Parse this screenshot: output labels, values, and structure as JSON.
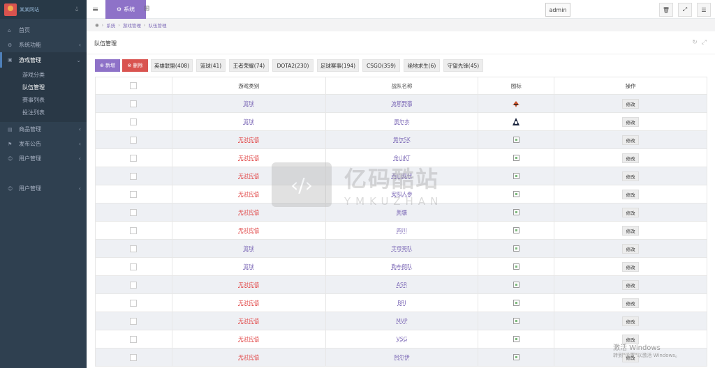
{
  "logo": {
    "text": "某某网站"
  },
  "sidebar": {
    "items": [
      {
        "label": "首页",
        "icon": "home-icon"
      },
      {
        "label": "系统功能",
        "icon": "gear-icon"
      },
      {
        "label": "游戏管理",
        "icon": "gamepad-icon"
      },
      {
        "label": "商品管理",
        "icon": "shop-icon"
      },
      {
        "label": "发布公告",
        "icon": "flag-icon"
      },
      {
        "label": "用户管理",
        "icon": "users-icon"
      },
      {
        "label": "用户管理",
        "icon": "users-icon"
      }
    ],
    "submenu": [
      "游戏分类",
      "队伍管理",
      "赛事列表",
      "投注列表"
    ]
  },
  "topbar": {
    "tab_label": "系统",
    "avatar_alt": "admin"
  },
  "breadcrumb": [
    "系统",
    "游戏管理",
    "队伍管理"
  ],
  "page": {
    "title": "队伍管理"
  },
  "toolbar": {
    "add_label": "新增",
    "delete_label": "删除"
  },
  "filters": [
    "英雄联盟(408)",
    "篮球(41)",
    "王者荣耀(74)",
    "DOTA2(230)",
    "足球赛事(194)",
    "CSGO(359)",
    "绝地求生(6)",
    "守望先锋(45)"
  ],
  "table": {
    "headers": [
      "游戏类别",
      "战队名称",
      "图标",
      "操作"
    ],
    "edit_label": "修改",
    "rows": [
      {
        "category": "篮球",
        "name": "波斯野猫",
        "icon": "logo-a"
      },
      {
        "category": "篮球",
        "name": "墨尔本",
        "icon": "logo-b"
      },
      {
        "category": "无对应值",
        "name": "黄尔SK",
        "icon": "broken"
      },
      {
        "category": "无对应值",
        "name": "金山KT",
        "icon": "broken"
      },
      {
        "category": "无对应值",
        "name": "西山现代",
        "icon": "broken"
      },
      {
        "category": "无对应值",
        "name": "安阳人参",
        "icon": "broken"
      },
      {
        "category": "无对应值",
        "name": "新疆",
        "icon": "broken"
      },
      {
        "category": "无对应值",
        "name": "四川",
        "icon": "broken"
      },
      {
        "category": "篮球",
        "name": "字母哥队",
        "icon": "broken"
      },
      {
        "category": "篮球",
        "name": "勒布朗队",
        "icon": "broken"
      },
      {
        "category": "无对应值",
        "name": "ASR",
        "icon": "broken"
      },
      {
        "category": "无对应值",
        "name": "BRI",
        "icon": "broken"
      },
      {
        "category": "无对应值",
        "name": "MVP",
        "icon": "broken"
      },
      {
        "category": "无对应值",
        "name": "VSG",
        "icon": "broken"
      },
      {
        "category": "无对应值",
        "name": "阿尔伊",
        "icon": "broken"
      }
    ]
  },
  "watermark": {
    "cn": "亿码酷站",
    "en": "YMKUZHAN"
  },
  "windows_activation": {
    "title": "激活 Windows",
    "subtitle": "转到\"设置\"以激活 Windows。"
  },
  "colors": {
    "accent": "#8e72c8",
    "danger": "#d9534f",
    "sidebar": "#2f4050"
  }
}
